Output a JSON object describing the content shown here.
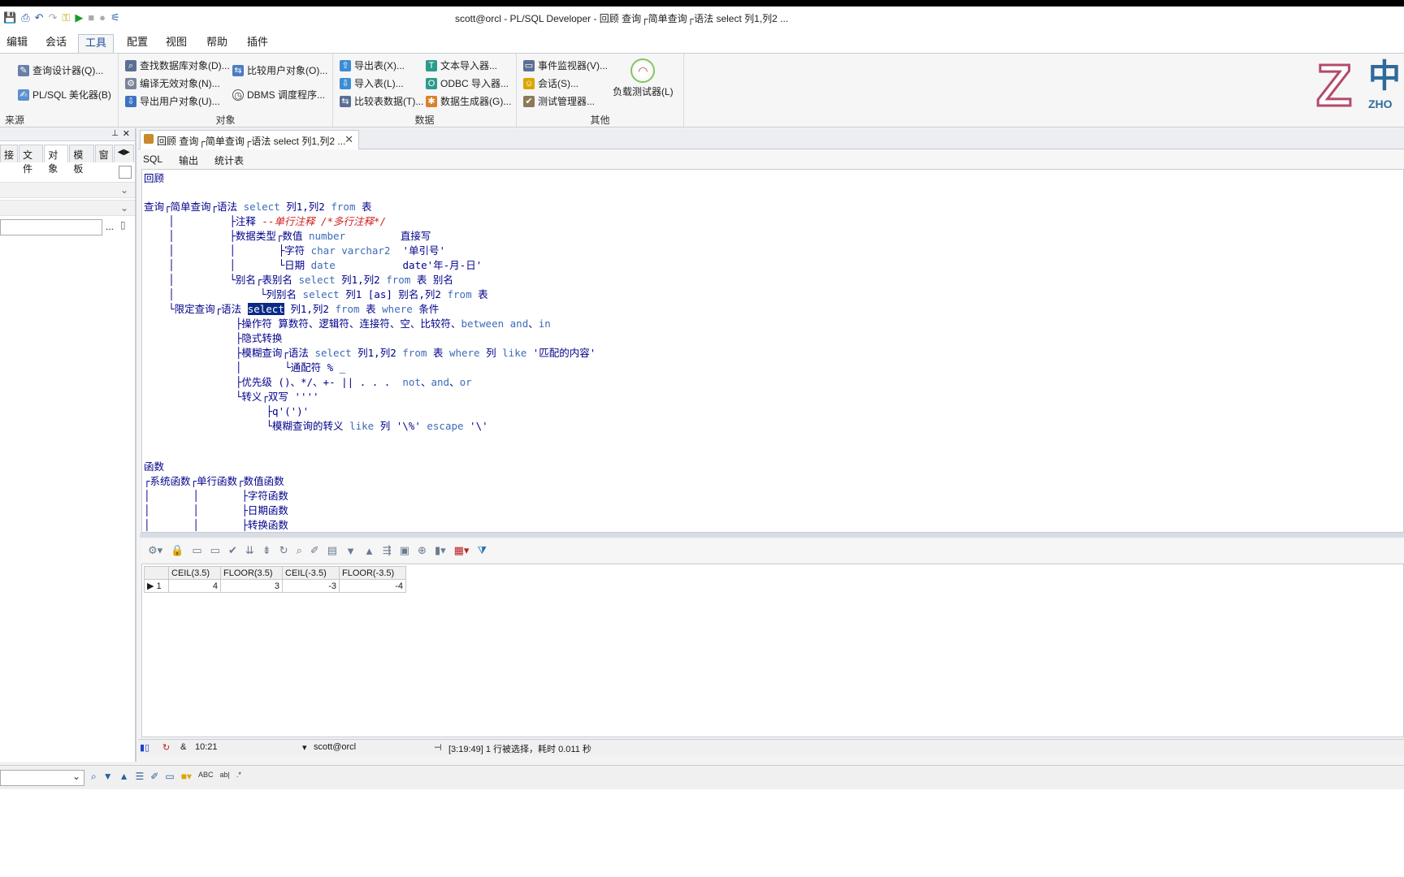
{
  "window": {
    "title": "scott@orcl - PL/SQL Developer - 回顾 查询┌简单查询┌语法 select 列1,列2 ..."
  },
  "menu": {
    "tabs": [
      "编辑",
      "会话",
      "工具",
      "配置",
      "视图",
      "帮助",
      "插件"
    ],
    "active": "工具"
  },
  "ribbon": {
    "source": {
      "label": "来源",
      "items": [
        "查询设计器(Q)...",
        "PL/SQL 美化器(B)"
      ]
    },
    "objects": {
      "label": "对象",
      "items": [
        "查找数据库对象(D)...",
        "比较用户对象(O)...",
        "编译无效对象(N)...",
        "DBMS 调度程序...",
        "导出用户对象(U)..."
      ]
    },
    "data": {
      "label": "数据",
      "items": [
        "导出表(X)...",
        "文本导入器...",
        "导入表(L)...",
        "ODBC 导入器...",
        "比较表数据(T)...",
        "数据生成器(G)..."
      ]
    },
    "other": {
      "label": "其他",
      "items": [
        "事件监视器(V)...",
        "会话(S)...",
        "测试管理器...",
        "负载测试器(L)"
      ]
    }
  },
  "left_panel": {
    "tabs": [
      "接",
      "文件",
      "对象",
      "模板",
      "窗"
    ],
    "active_tab": "对象",
    "ellipsis": "..."
  },
  "document": {
    "tab_title": "回顾 查询┌简单查询┌语法 select 列1,列2 ...",
    "subtabs": [
      "SQL",
      "输出",
      "统计表"
    ]
  },
  "editor": {
    "l1": "回顾",
    "l3a": "查询┌简单查询┌语法 ",
    "l3b": "select",
    "l3c": " 列1,列2 ",
    "l3d": "from",
    "l3e": " 表",
    "l4a": "    │         ├注释 ",
    "l4b": "--单行注释 /*多行注释*/",
    "l5a": "    │         ├数据类型┌数值 ",
    "l5b": "number",
    "l5c": "         直接写",
    "l6a": "    │         │       ├字符 ",
    "l6b": "char varchar2",
    "l6c": "  '单引号'",
    "l7a": "    │         │       └日期 ",
    "l7b": "date",
    "l7c": "           date'年-月-日'",
    "l8a": "    │         └别名┌表别名 ",
    "l8b": "select",
    "l8c": " 列1,列2 ",
    "l8d": "from",
    "l8e": " 表 别名",
    "l9a": "    │              └列别名 ",
    "l9b": "select",
    "l9c": " 列1 [as] 别名,列2 ",
    "l9d": "from",
    "l9e": " 表",
    "l10a": "    └限定查询┌语法 ",
    "l10b": "select",
    "l10c": " 列1,列2 ",
    "l10d": "from",
    "l10e": " 表 ",
    "l10f": "where",
    "l10g": " 条件",
    "l11a": "               ├操作符 算数符、逻辑符、连接符、空、比较符、",
    "l11b": "between and",
    "l11c": "、",
    "l11d": "in",
    "l12": "               ├隐式转换",
    "l13a": "               ├模糊查询┌语法 ",
    "l13b": "select",
    "l13c": " 列1,列2 ",
    "l13d": "from",
    "l13e": " 表 ",
    "l13f": "where",
    "l13g": " 列 ",
    "l13h": "like",
    "l13i": " '匹配的内容'",
    "l14": "               │       └通配符 % _",
    "l15a": "               ├优先级 ()、*/、+- || . . .  ",
    "l15b": "not",
    "l15c": "、",
    "l15d": "and",
    "l15e": "、",
    "l15f": "or",
    "l16": "               └转义┌双写 ''''",
    "l17": "                    ├q'(')'",
    "l18a": "                    └模糊查询的转义 ",
    "l18b": "like",
    "l18c": " 列 '\\%' ",
    "l18d": "escape",
    "l18e": " '\\'",
    "l21": "函数",
    "l22": "┌系统函数┌单行函数┌数值函数",
    "l23": "│       │       ├字符函数",
    "l24": "│       │       ├日期函数",
    "l25": "│       │       ├转换函数"
  },
  "grid": {
    "columns": [
      "CEIL(3.5)",
      "FLOOR(3.5)",
      "CEIL(-3.5)",
      "FLOOR(-3.5)"
    ],
    "rows": [
      {
        "n": "1",
        "c1": "4",
        "c2": "3",
        "c3": "-3",
        "c4": "-4"
      }
    ]
  },
  "status": {
    "position": "10:21",
    "connection": "scott@orcl",
    "message": "[3:19:49]  1 行被选择，耗时 0.011 秒"
  },
  "logo": {
    "letter": "Z",
    "cjk": "中",
    "text": "ZHO"
  }
}
